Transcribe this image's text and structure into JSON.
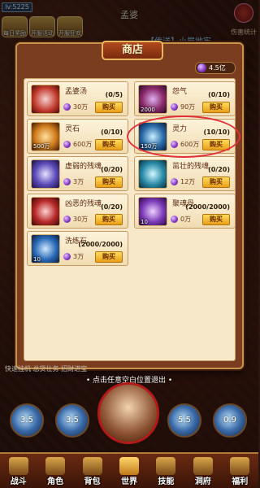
{
  "header": {
    "level_text": "lv:5225",
    "npc_name": "孟婆",
    "quest_text": "【传送】小屋地牢",
    "top_icons": [
      "每日奖励",
      "开服活动",
      "开服狂欢"
    ],
    "damage_stats": "伤害统计"
  },
  "shop": {
    "title": "商店",
    "currency": "4.5亿",
    "buy_label": "购买",
    "items": [
      {
        "name": "孟婆汤",
        "price": "30万",
        "stock": "(0/5)",
        "qty": "",
        "icon": "soup-icon",
        "color": "#c0392b"
      },
      {
        "name": "怨气",
        "price": "90万",
        "stock": "(0/10)",
        "qty": "2000",
        "icon": "resentment-orb-icon",
        "color": "#8a2a6a"
      },
      {
        "name": "灵石",
        "price": "600万",
        "stock": "(0/10)",
        "qty": "500万",
        "icon": "spirit-stone-icon",
        "color": "#d07a1a"
      },
      {
        "name": "灵力",
        "price": "600万",
        "stock": "(10/10)",
        "qty": "150万",
        "icon": "spirit-power-icon",
        "color": "#2a6aa8"
      },
      {
        "name": "虚弱的残魂",
        "price": "3万",
        "stock": "(0/20)",
        "qty": "",
        "icon": "weak-soul-icon",
        "color": "#5a4ab8"
      },
      {
        "name": "茁壮的残魂",
        "price": "12万",
        "stock": "(0/20)",
        "qty": "",
        "icon": "strong-soul-icon",
        "color": "#2a8aa8"
      },
      {
        "name": "凶恶的残魂",
        "price": "30万",
        "stock": "(0/20)",
        "qty": "",
        "icon": "fierce-soul-icon",
        "color": "#b82a2a"
      },
      {
        "name": "聚魂丹",
        "price": "0万",
        "stock": "(2000/2000)",
        "qty": "10",
        "icon": "soul-pill-icon",
        "color": "#7a3ab8"
      },
      {
        "name": "洗练石",
        "price": "3万",
        "stock": "(2000/2000)",
        "qty": "10",
        "icon": "refining-stone-icon",
        "color": "#2a6ab8"
      }
    ]
  },
  "footer": {
    "exit_hint": "• 点击任意空白位置退出 •",
    "side_info": "快速挂机  总货仕务  招财进宝",
    "skills": [
      "3.5",
      "3.5",
      "5.5",
      "0.9"
    ],
    "nav": [
      "战斗",
      "角色",
      "背包",
      "世界",
      "技能",
      "洞府",
      "福利"
    ]
  }
}
